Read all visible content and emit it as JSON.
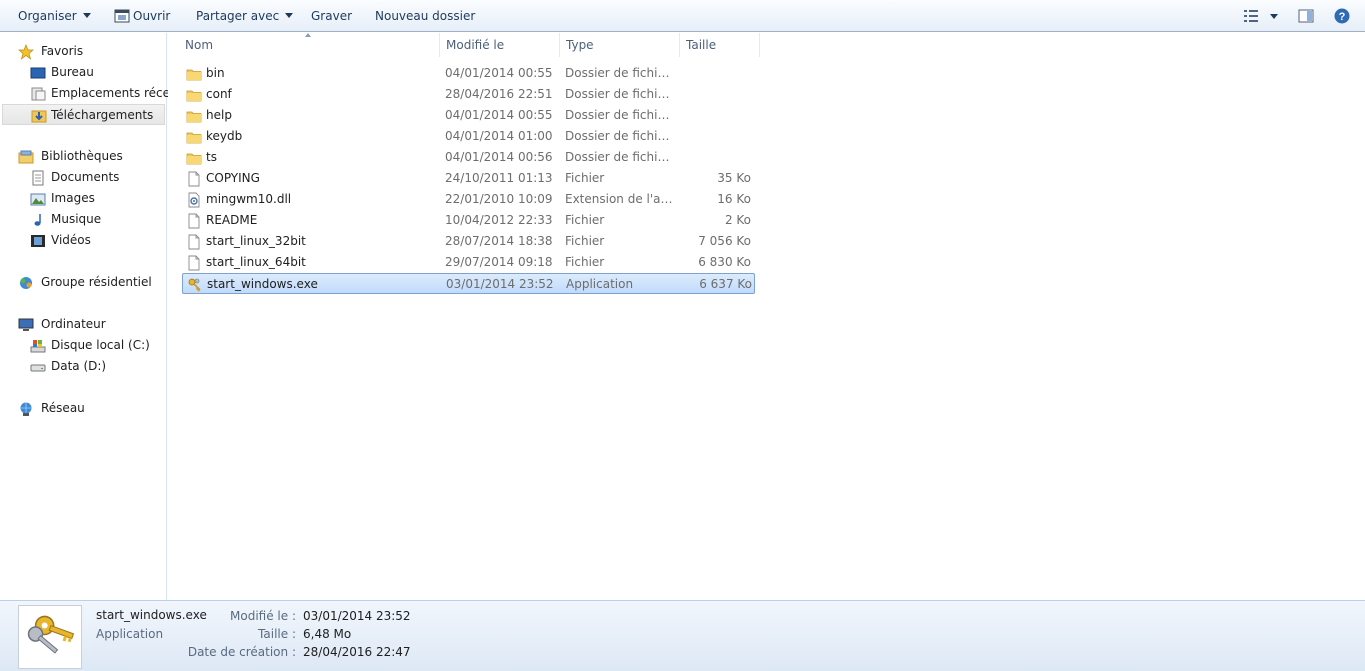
{
  "toolbar": {
    "organiser": "Organiser",
    "ouvrir": "Ouvrir",
    "partager": "Partager avec",
    "graver": "Graver",
    "nouveau_dossier": "Nouveau dossier"
  },
  "nav": {
    "favoris": "Favoris",
    "bureau": "Bureau",
    "emplacements": "Emplacements récent",
    "telechargements": "Téléchargements",
    "bibliotheques": "Bibliothèques",
    "documents": "Documents",
    "images": "Images",
    "musique": "Musique",
    "videos": "Vidéos",
    "groupe": "Groupe résidentiel",
    "ordinateur": "Ordinateur",
    "disque_c": "Disque local (C:)",
    "data_d": "Data (D:)",
    "reseau": "Réseau"
  },
  "columns": {
    "nom": "Nom",
    "modifie": "Modifié le",
    "type": "Type",
    "taille": "Taille"
  },
  "files": [
    {
      "name": "bin",
      "date": "04/01/2014 00:55",
      "type": "Dossier de fichiers",
      "size": "",
      "icon": "folder-icon"
    },
    {
      "name": "conf",
      "date": "28/04/2016 22:51",
      "type": "Dossier de fichiers",
      "size": "",
      "icon": "folder-icon"
    },
    {
      "name": "help",
      "date": "04/01/2014 00:55",
      "type": "Dossier de fichiers",
      "size": "",
      "icon": "folder-icon"
    },
    {
      "name": "keydb",
      "date": "04/01/2014 01:00",
      "type": "Dossier de fichiers",
      "size": "",
      "icon": "folder-icon"
    },
    {
      "name": "ts",
      "date": "04/01/2014 00:56",
      "type": "Dossier de fichiers",
      "size": "",
      "icon": "folder-icon"
    },
    {
      "name": "COPYING",
      "date": "24/10/2011 01:13",
      "type": "Fichier",
      "size": "35 Ko",
      "icon": "file-icon"
    },
    {
      "name": "mingwm10.dll",
      "date": "22/01/2010 10:09",
      "type": "Extension de l'app...",
      "size": "16 Ko",
      "icon": "dll-file-icon"
    },
    {
      "name": "README",
      "date": "10/04/2012 22:33",
      "type": "Fichier",
      "size": "2 Ko",
      "icon": "file-icon"
    },
    {
      "name": "start_linux_32bit",
      "date": "28/07/2014 18:38",
      "type": "Fichier",
      "size": "7 056 Ko",
      "icon": "file-icon"
    },
    {
      "name": "start_linux_64bit",
      "date": "29/07/2014 09:18",
      "type": "Fichier",
      "size": "6 830 Ko",
      "icon": "file-icon"
    },
    {
      "name": "start_windows.exe",
      "date": "03/01/2014 23:52",
      "type": "Application",
      "size": "6 637 Ko",
      "icon": "keys-app-icon",
      "selected": true
    }
  ],
  "details": {
    "name": "start_windows.exe",
    "type": "Application",
    "modifie_label": "Modifié le :",
    "modifie_value": "03/01/2014 23:52",
    "taille_label": "Taille :",
    "taille_value": "6,48 Mo",
    "creation_label": "Date de création :",
    "creation_value": "28/04/2016 22:47"
  }
}
